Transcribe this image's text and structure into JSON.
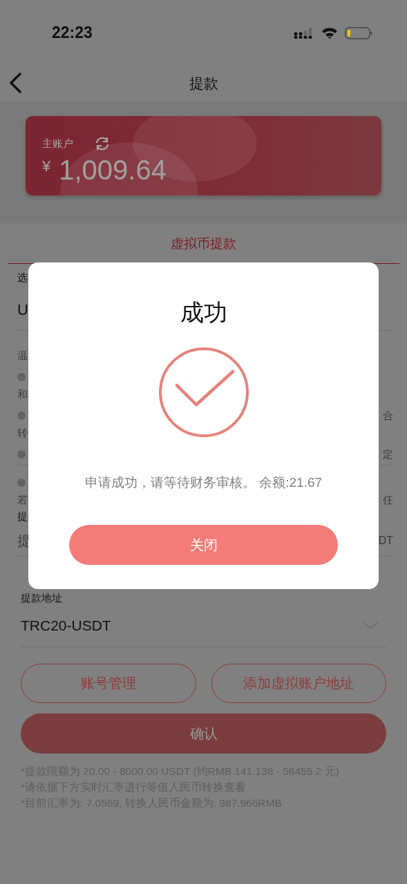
{
  "status_bar": {
    "time": "22:23"
  },
  "nav": {
    "title": "提款"
  },
  "account_card": {
    "label": "主账户",
    "currency": "¥",
    "amount": "1,009.64"
  },
  "tabs": [
    {
      "label": "虚拟币提款",
      "selected": true
    }
  ],
  "obscured_rows": [
    {
      "kind": "label",
      "left": "选"
    },
    {
      "kind": "value",
      "left": "U"
    },
    {
      "kind": "divider"
    },
    {
      "kind": "note",
      "left": "温"
    },
    {
      "kind": "bullet"
    },
    {
      "kind": "note",
      "left": "和"
    },
    {
      "kind": "bullet",
      "right": "合"
    },
    {
      "kind": "note",
      "left": "转"
    },
    {
      "kind": "bullet",
      "right": "定"
    },
    {
      "kind": "divider"
    },
    {
      "kind": "bullet"
    },
    {
      "kind": "note",
      "left": "若",
      "right": "任"
    },
    {
      "kind": "label",
      "left": "提"
    },
    {
      "kind": "placeholder",
      "left": "提",
      "right": "DT"
    }
  ],
  "address": {
    "label": "提款地址",
    "value": "TRC20-USDT"
  },
  "buttons": [
    {
      "label": "账号管理",
      "kind": "outline"
    },
    {
      "label": "添加虚拟账户地址",
      "kind": "outline"
    }
  ],
  "confirm": {
    "label": "确认"
  },
  "notes": [
    "*提款限额为 20.00 - 8000.00 USDT (约RMB 141.138 - 56455.2 元)",
    "*请依据下方实时汇率进行等值人民币转换查看",
    "*目前汇率为: 7.0569, 转换人民币金额为: 987.966RMB"
  ],
  "dialog": {
    "title": "成功",
    "message": "申请成功，请等待财务审核。 余额:21.67",
    "button": "关闭"
  }
}
